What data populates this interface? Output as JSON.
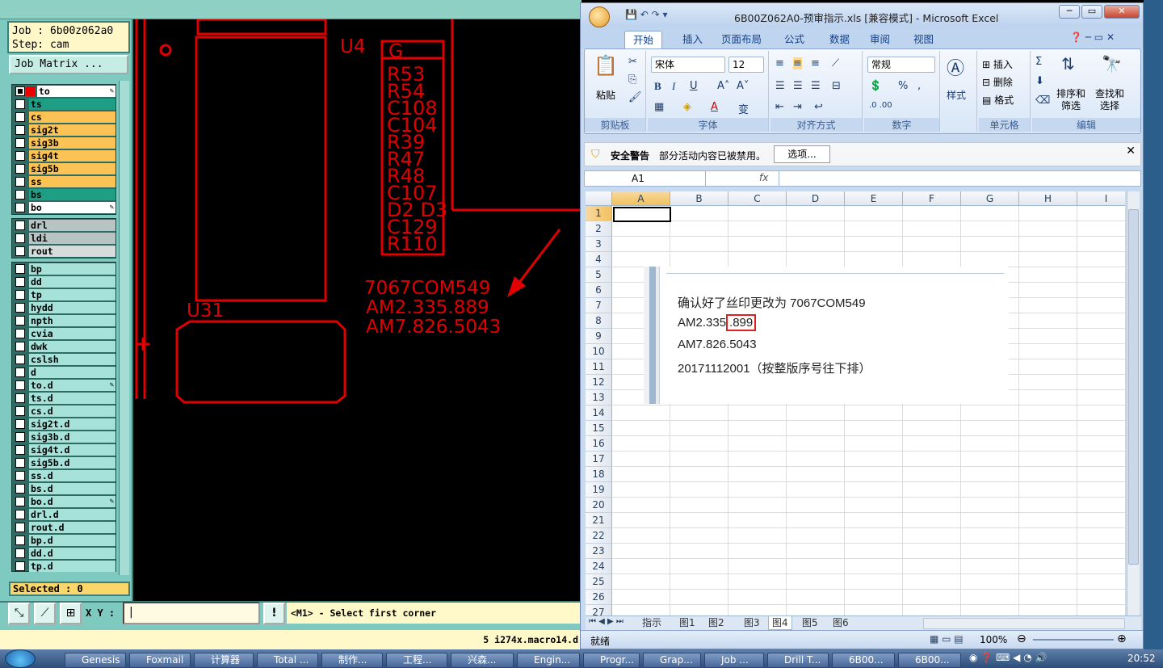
{
  "genesis": {
    "job_label": "Job : 6b00z062a0",
    "step_label": "Step: cam",
    "job_matrix_btn": "Job Matrix ...",
    "layers_group1": [
      {
        "name": "to",
        "color": "#ffffff"
      },
      {
        "name": "ts",
        "color": "#1f9e86"
      },
      {
        "name": "cs",
        "color": "#fbc356"
      },
      {
        "name": "sig2t",
        "color": "#fbc356"
      },
      {
        "name": "sig3b",
        "color": "#fbc356"
      },
      {
        "name": "sig4t",
        "color": "#fbc356"
      },
      {
        "name": "sig5b",
        "color": "#fbc356"
      },
      {
        "name": "ss",
        "color": "#fbc356"
      },
      {
        "name": "bs",
        "color": "#1f9e86"
      },
      {
        "name": "bo",
        "color": "#ffffff"
      }
    ],
    "layers_group2": [
      {
        "name": "drl",
        "color": "#b8c4c4"
      },
      {
        "name": "ldi",
        "color": "#b8c4c4"
      },
      {
        "name": "rout",
        "color": "#d6dcdc"
      }
    ],
    "layers_group3": [
      "bp",
      "dd",
      "tp",
      "hydd",
      "npth",
      "cvia",
      "dwk",
      "cslsh",
      "d",
      "to.d",
      "ts.d",
      "cs.d",
      "sig2t.d",
      "sig3b.d",
      "sig4t.d",
      "sig5b.d",
      "ss.d",
      "bs.d",
      "bo.d",
      "drl.d",
      "rout.d",
      "bp.d",
      "dd.d",
      "tp.d"
    ],
    "selected": "Selected : 0",
    "xy_label": "X Y :",
    "xy_value": "",
    "command_status": "<M1> - Select first corner",
    "macro_status": "5 i274x.macro14.d",
    "canvas": {
      "u4": "U4",
      "u31": "U31",
      "g": "G",
      "parts": [
        "R53",
        "R54",
        "C108",
        "C104",
        "R39",
        "R47",
        "R48",
        "C107",
        "D2 D3",
        "C129",
        "R110"
      ],
      "line1": "7067COM549",
      "line2": "AM2.335.889",
      "line3": "AM7.826.5043"
    }
  },
  "excel": {
    "title": "6B00Z062A0-预审指示.xls  [兼容模式] - Microsoft Excel",
    "tabs": [
      "开始",
      "插入",
      "页面布局",
      "公式",
      "数据",
      "审阅",
      "视图"
    ],
    "clipboard": {
      "paste": "粘贴",
      "label": "剪贴板"
    },
    "font": {
      "name": "宋体",
      "size": "12",
      "label": "字体"
    },
    "align_label": "对齐方式",
    "number": {
      "format": "常规",
      "label": "数字"
    },
    "styles": "样式",
    "cells": {
      "insert": "插入",
      "delete": "删除",
      "format": "格式",
      "label": "单元格"
    },
    "editing": {
      "sort": "排序和",
      "filter": "筛选",
      "find": "查找和",
      "select": "选择",
      "label": "编辑"
    },
    "security": {
      "title": "安全警告",
      "msg": "部分活动内容已被禁用。",
      "options": "选项..."
    },
    "namebox": "A1",
    "fx": "fx",
    "columns": [
      "A",
      "B",
      "C",
      "D",
      "E",
      "F",
      "G",
      "H",
      "I"
    ],
    "rows": [
      "1",
      "2",
      "3",
      "4",
      "5",
      "6",
      "7",
      "8",
      "9",
      "10",
      "11",
      "12",
      "13",
      "14",
      "15",
      "16",
      "17",
      "18",
      "19",
      "20",
      "21",
      "22",
      "23",
      "24",
      "25",
      "26",
      "27"
    ],
    "note": {
      "l1": "确认好了丝印更改为 7067COM549",
      "l2a": "AM2.335",
      "l2b": ".899",
      "l3": "AM7.826.5043",
      "l4": "20171112001（按整版序号往下排）"
    },
    "sheet_tabs": [
      "指示",
      "图1",
      "图2",
      "图3",
      "图4",
      "图5",
      "图6"
    ],
    "status": "就绪",
    "zoom": "100%"
  },
  "taskbar": {
    "items": [
      "Genesis",
      "Foxmail",
      "计算器",
      "Total ...",
      "制作...",
      "工程...",
      "兴森...",
      "Engin...",
      "Progr...",
      "Grap...",
      "Job ...",
      "Drill T...",
      "6B00...",
      "6B00..."
    ],
    "clock": "20:52"
  }
}
